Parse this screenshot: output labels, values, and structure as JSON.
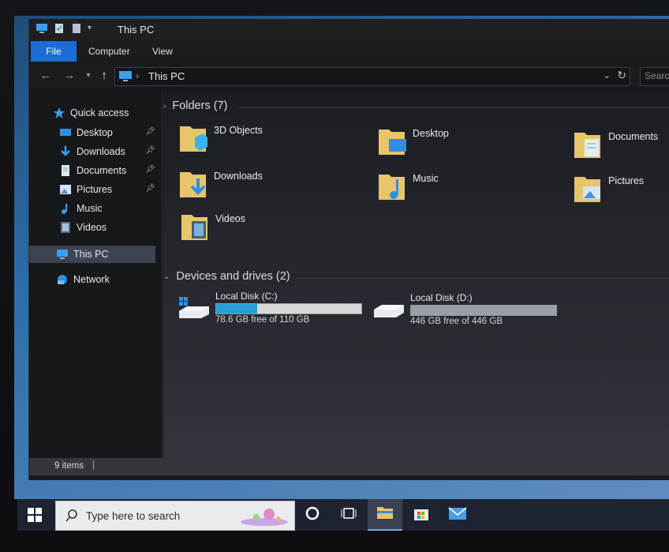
{
  "window": {
    "title": "This PC",
    "ribbon_tabs": [
      "File",
      "Computer",
      "View"
    ],
    "address": {
      "path_label": "This PC",
      "search_placeholder": "Search"
    }
  },
  "nav": {
    "quick_access_label": "Quick access",
    "items": [
      {
        "label": "Desktop",
        "icon": "desktop-icon",
        "pinned": true
      },
      {
        "label": "Downloads",
        "icon": "download-arrow-icon",
        "pinned": true
      },
      {
        "label": "Documents",
        "icon": "document-icon",
        "pinned": true
      },
      {
        "label": "Pictures",
        "icon": "picture-icon",
        "pinned": true
      },
      {
        "label": "Music",
        "icon": "music-note-icon",
        "pinned": false
      },
      {
        "label": "Videos",
        "icon": "film-icon",
        "pinned": false
      }
    ],
    "this_pc_label": "This PC",
    "network_label": "Network"
  },
  "folders": {
    "header": "Folders (7)",
    "items": [
      {
        "label": "3D Objects",
        "icon": "3d-cube-icon"
      },
      {
        "label": "Desktop",
        "icon": "desktop-icon"
      },
      {
        "label": "Documents",
        "icon": "document-icon"
      },
      {
        "label": "Downloads",
        "icon": "download-arrow-icon"
      },
      {
        "label": "Music",
        "icon": "music-note-icon"
      },
      {
        "label": "Pictures",
        "icon": "picture-icon"
      },
      {
        "label": "Videos",
        "icon": "film-icon"
      }
    ]
  },
  "drives": {
    "header": "Devices and drives (2)",
    "items": [
      {
        "name": "Local Disk (C:)",
        "free_text": "78.6 GB free of 110 GB",
        "used_fraction": 0.285,
        "bar_color": "#26a0da",
        "icon": "windows-drive-icon"
      },
      {
        "name": "Local Disk (D:)",
        "free_text": "446 GB free of 446 GB",
        "used_fraction": 0.0,
        "bar_color": "#26a0da",
        "icon": "drive-icon"
      }
    ]
  },
  "status": {
    "item_count": "9 items",
    "separator": "|"
  },
  "taskbar": {
    "search_placeholder": "Type here to search",
    "buttons": [
      "cortana-icon",
      "task-view-icon",
      "file-explorer-icon",
      "store-icon",
      "mail-icon"
    ]
  },
  "colors": {
    "accent": "#1a6dd6",
    "drive_bar_fill": "#26a0da",
    "folder_yellow": "#e8c56a"
  }
}
